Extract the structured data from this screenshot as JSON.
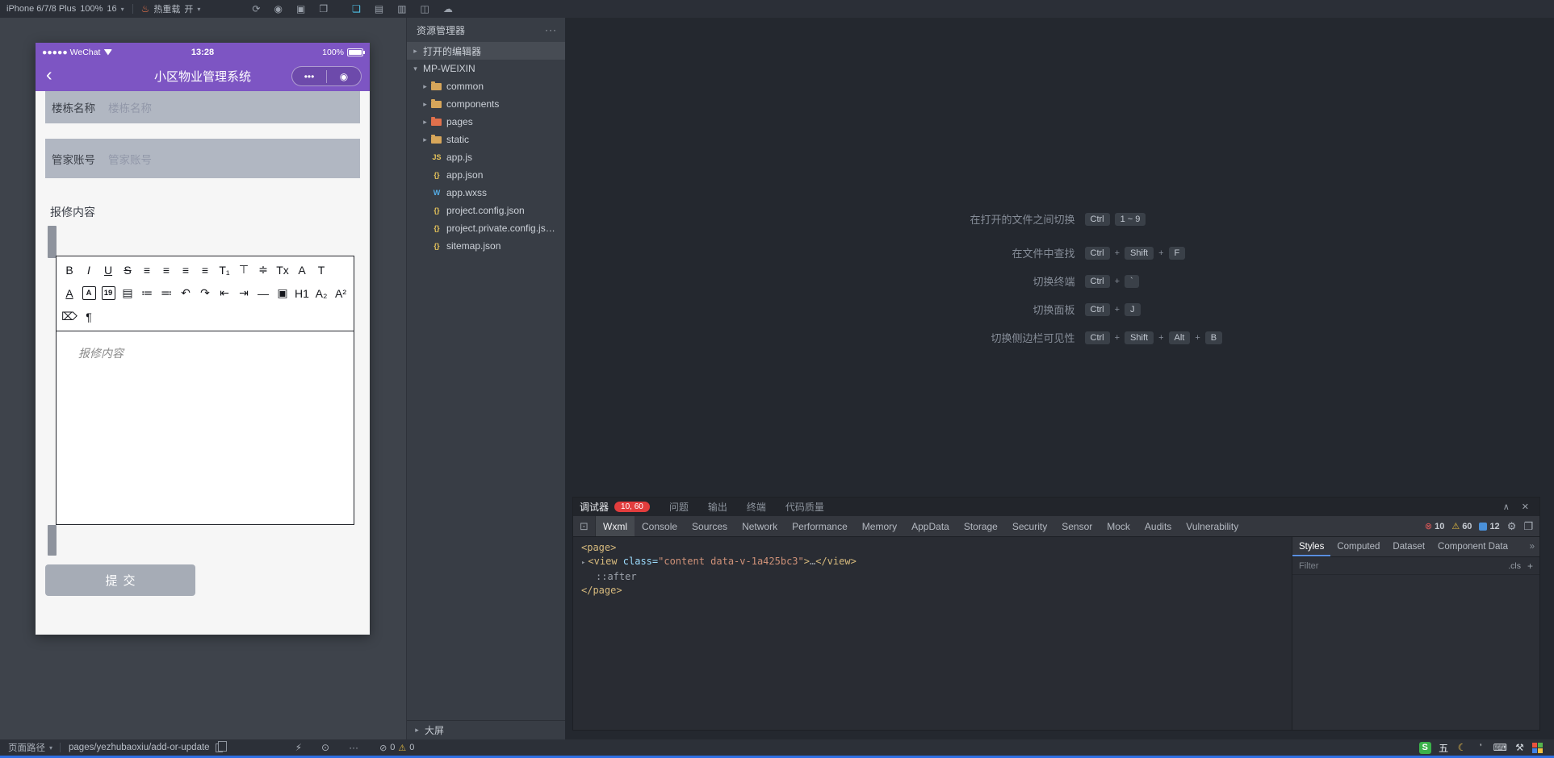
{
  "colors": {
    "nav_purple": "#7d55c3",
    "badge_red": "#e23d3d",
    "accent_cyan": "#4fc3e8",
    "taskbar_blue": "#2f6fe4"
  },
  "toolbar": {
    "device_label": "iPhone 6/7/8 Plus",
    "zoom_label": "100%",
    "network_label": "16",
    "caret": "▾",
    "hot_reload_icon": "♨",
    "hot_reload_label": "热重载",
    "hot_reload_state": "开",
    "icon_groups": [
      [
        {
          "name": "rotate-icon",
          "glyph": "⟳"
        },
        {
          "name": "record-icon",
          "glyph": "◉"
        },
        {
          "name": "screenshot-icon",
          "glyph": "▣"
        },
        {
          "name": "window-icon",
          "glyph": "❐"
        }
      ],
      [
        {
          "name": "layers-icon",
          "glyph": "❏",
          "active": true
        },
        {
          "name": "grid-icon",
          "glyph": "▤"
        },
        {
          "name": "layout-icon",
          "glyph": "▥"
        },
        {
          "name": "split-icon",
          "glyph": "◫"
        },
        {
          "name": "cloud-icon",
          "glyph": "☁"
        }
      ]
    ]
  },
  "simulator": {
    "status": {
      "carrier": "●●●●● WeChat",
      "time": "13:28",
      "battery": "100%"
    },
    "nav": {
      "back": "‹",
      "title": "小区物业管理系统",
      "menu": "•••",
      "close": "◉"
    },
    "form": {
      "fields": [
        {
          "label": "楼栋名称",
          "placeholder": "楼栋名称"
        },
        {
          "label": "管家账号",
          "placeholder": "管家账号"
        }
      ],
      "content_label": "报修内容",
      "editor_placeholder": "报修内容",
      "submit_label": "提交",
      "toolbar_rows": [
        [
          {
            "name": "bold-icon",
            "glyph": "B"
          },
          {
            "name": "italic-icon",
            "glyph": "I",
            "italic": true
          },
          {
            "name": "underline-icon",
            "glyph": "U",
            "underline": true
          },
          {
            "name": "strikethrough-icon",
            "glyph": "S",
            "strike": true
          },
          {
            "name": "align-left-icon",
            "glyph": "≡"
          },
          {
            "name": "align-center-icon",
            "glyph": "≡"
          },
          {
            "name": "align-right-icon",
            "glyph": "≡"
          },
          {
            "name": "align-justify-icon",
            "glyph": "≡"
          },
          {
            "name": "title-icon",
            "glyph": "T₁"
          },
          {
            "name": "header-icon",
            "glyph": "⊤"
          },
          {
            "name": "line-height-icon",
            "glyph": "≑"
          },
          {
            "name": "clear-format-icon",
            "glyph": "Tx"
          },
          {
            "name": "font-size-icon",
            "glyph": "A"
          },
          {
            "name": "font-icon",
            "glyph": "T"
          }
        ],
        [
          {
            "name": "text-color-icon",
            "glyph": "A",
            "underline": true
          },
          {
            "name": "highlight-icon",
            "glyph": "A",
            "boxed": true
          },
          {
            "name": "date-icon",
            "glyph": "19",
            "boxed": true
          },
          {
            "name": "clipboard-icon",
            "glyph": "▤"
          },
          {
            "name": "ordered-list-icon",
            "glyph": "≔"
          },
          {
            "name": "unordered-list-icon",
            "glyph": "≕"
          },
          {
            "name": "undo-icon",
            "glyph": "↶"
          },
          {
            "name": "redo-icon",
            "glyph": "↷"
          },
          {
            "name": "outdent-icon",
            "glyph": "⇤"
          },
          {
            "name": "indent-icon",
            "glyph": "⇥"
          },
          {
            "name": "divider-icon",
            "glyph": "—"
          },
          {
            "name": "image-icon",
            "glyph": "▣"
          },
          {
            "name": "h1-icon",
            "glyph": "H1"
          },
          {
            "name": "subscript-icon",
            "glyph": "A₂"
          },
          {
            "name": "superscript-icon",
            "glyph": "A²"
          }
        ],
        [
          {
            "name": "trash-icon",
            "glyph": "⌦"
          },
          {
            "name": "paragraph-icon",
            "glyph": "¶"
          }
        ]
      ]
    }
  },
  "explorer": {
    "title": "资源管理器",
    "kebab": "···",
    "sections": [
      {
        "arrow": "▸",
        "label": "打开的编辑器"
      },
      {
        "arrow": "▾",
        "label": "MP-WEIXIN"
      }
    ],
    "folder_arrow": "▸",
    "tree": [
      {
        "type": "folder",
        "name": "common",
        "icon_color": "#d7a65a"
      },
      {
        "type": "folder",
        "name": "components",
        "icon_color": "#d7a65a"
      },
      {
        "type": "folder",
        "name": "pages",
        "icon_color": "#e0704c"
      },
      {
        "type": "folder",
        "name": "static",
        "icon_color": "#d7a65a"
      },
      {
        "type": "file",
        "name": "app.js",
        "icon_glyph": "JS",
        "icon_color": "#e8c55a"
      },
      {
        "type": "file",
        "name": "app.json",
        "icon_glyph": "{}",
        "icon_color": "#e8c55a"
      },
      {
        "type": "file",
        "name": "app.wxss",
        "icon_glyph": "W",
        "icon_color": "#55aee8"
      },
      {
        "type": "file",
        "name": "project.config.json",
        "icon_glyph": "{}",
        "icon_color": "#e8c55a"
      },
      {
        "type": "file",
        "name": "project.private.config.js…",
        "icon_glyph": "{}",
        "icon_color": "#e8c55a"
      },
      {
        "type": "file",
        "name": "sitemap.json",
        "icon_glyph": "{}",
        "icon_color": "#e8c55a"
      }
    ],
    "footer_arrow": "▸",
    "footer_label": "大屏"
  },
  "shortcuts": [
    {
      "label": "在打开的文件之间切换",
      "keys": [
        "Ctrl",
        "1 ~ 9"
      ],
      "plus": false
    },
    {
      "label": "在文件中查找",
      "keys": [
        "Ctrl",
        "Shift",
        "F"
      ],
      "plus": true
    },
    {
      "label": "切换终端",
      "keys": [
        "Ctrl",
        "`"
      ],
      "plus": true
    },
    {
      "label": "切换面板",
      "keys": [
        "Ctrl",
        "J"
      ],
      "plus": true
    },
    {
      "label": "切换侧边栏可见性",
      "keys": [
        "Ctrl",
        "Shift",
        "Alt",
        "B"
      ],
      "plus": true
    }
  ],
  "debugger": {
    "tabs": [
      "调试器",
      "问题",
      "输出",
      "终端",
      "代码质量"
    ],
    "badge": "10, 60",
    "collapse_icon": "∧",
    "close_icon": "✕",
    "inspect_icon": "⊡",
    "devtools_tabs": [
      "Wxml",
      "Console",
      "Sources",
      "Network",
      "Performance",
      "Memory",
      "AppData",
      "Storage",
      "Security",
      "Sensor",
      "Mock",
      "Audits",
      "Vulnerability"
    ],
    "error_icon": "⊗",
    "warning_icon": "⚠",
    "counts": {
      "errors": "10",
      "warnings": "60",
      "messages": "12"
    },
    "gear_icon": "⚙",
    "dock_icon": "❐",
    "code_lines": [
      {
        "tokens": [
          {
            "t": "<page>",
            "c": "tag"
          }
        ]
      },
      {
        "arrow": "▸",
        "tokens": [
          {
            "t": "<view",
            "c": "tag"
          },
          {
            "t": " class=",
            "c": "attr"
          },
          {
            "t": "\"content data-v-1a425bc3\"",
            "c": "str"
          },
          {
            "t": ">",
            "c": "tag"
          },
          {
            "t": "…",
            "c": "dim"
          },
          {
            "t": "</view>",
            "c": "tag"
          }
        ]
      },
      {
        "indent": true,
        "tokens": [
          {
            "t": "::after",
            "c": "dim"
          }
        ]
      },
      {
        "tokens": [
          {
            "t": "</page>",
            "c": "tag"
          }
        ]
      }
    ],
    "styles_tabs": [
      "Styles",
      "Computed",
      "Dataset",
      "Component Data"
    ],
    "more_icon": "»",
    "filter_placeholder": "Filter",
    "cls_label": ".cls",
    "plus_icon": "+"
  },
  "statusbar": {
    "page_path_label": "页面路径",
    "caret": "▾",
    "path": "pages/yezhubaoxiu/add-or-update",
    "bolt_icon": "⚡",
    "eye_icon": "⊙",
    "more_icon": "···",
    "problems": {
      "clear_icon": "⊘",
      "errors": "0",
      "warn_icon": "⚠",
      "warnings": "0"
    },
    "tray": [
      {
        "name": "sogou-icon",
        "glyph": "S",
        "fg": "#ffffff",
        "bg": "#3bb24a"
      },
      {
        "name": "wubi-icon",
        "glyph": "五",
        "fg": "#e9edf2"
      },
      {
        "name": "moon-icon",
        "glyph": "☾",
        "fg": "#f0c24b"
      },
      {
        "name": "comma-icon",
        "glyph": "’",
        "fg": "#e9edf2"
      },
      {
        "name": "keyboard-icon",
        "glyph": "⌨",
        "fg": "#d4d9df"
      },
      {
        "name": "tools-icon",
        "glyph": "⚒",
        "fg": "#d4d9df"
      },
      {
        "name": "ime-grid-icon",
        "special": "grid",
        "colors": [
          "#e8533f",
          "#56b44c",
          "#3f83e8",
          "#f2c040"
        ]
      }
    ]
  }
}
